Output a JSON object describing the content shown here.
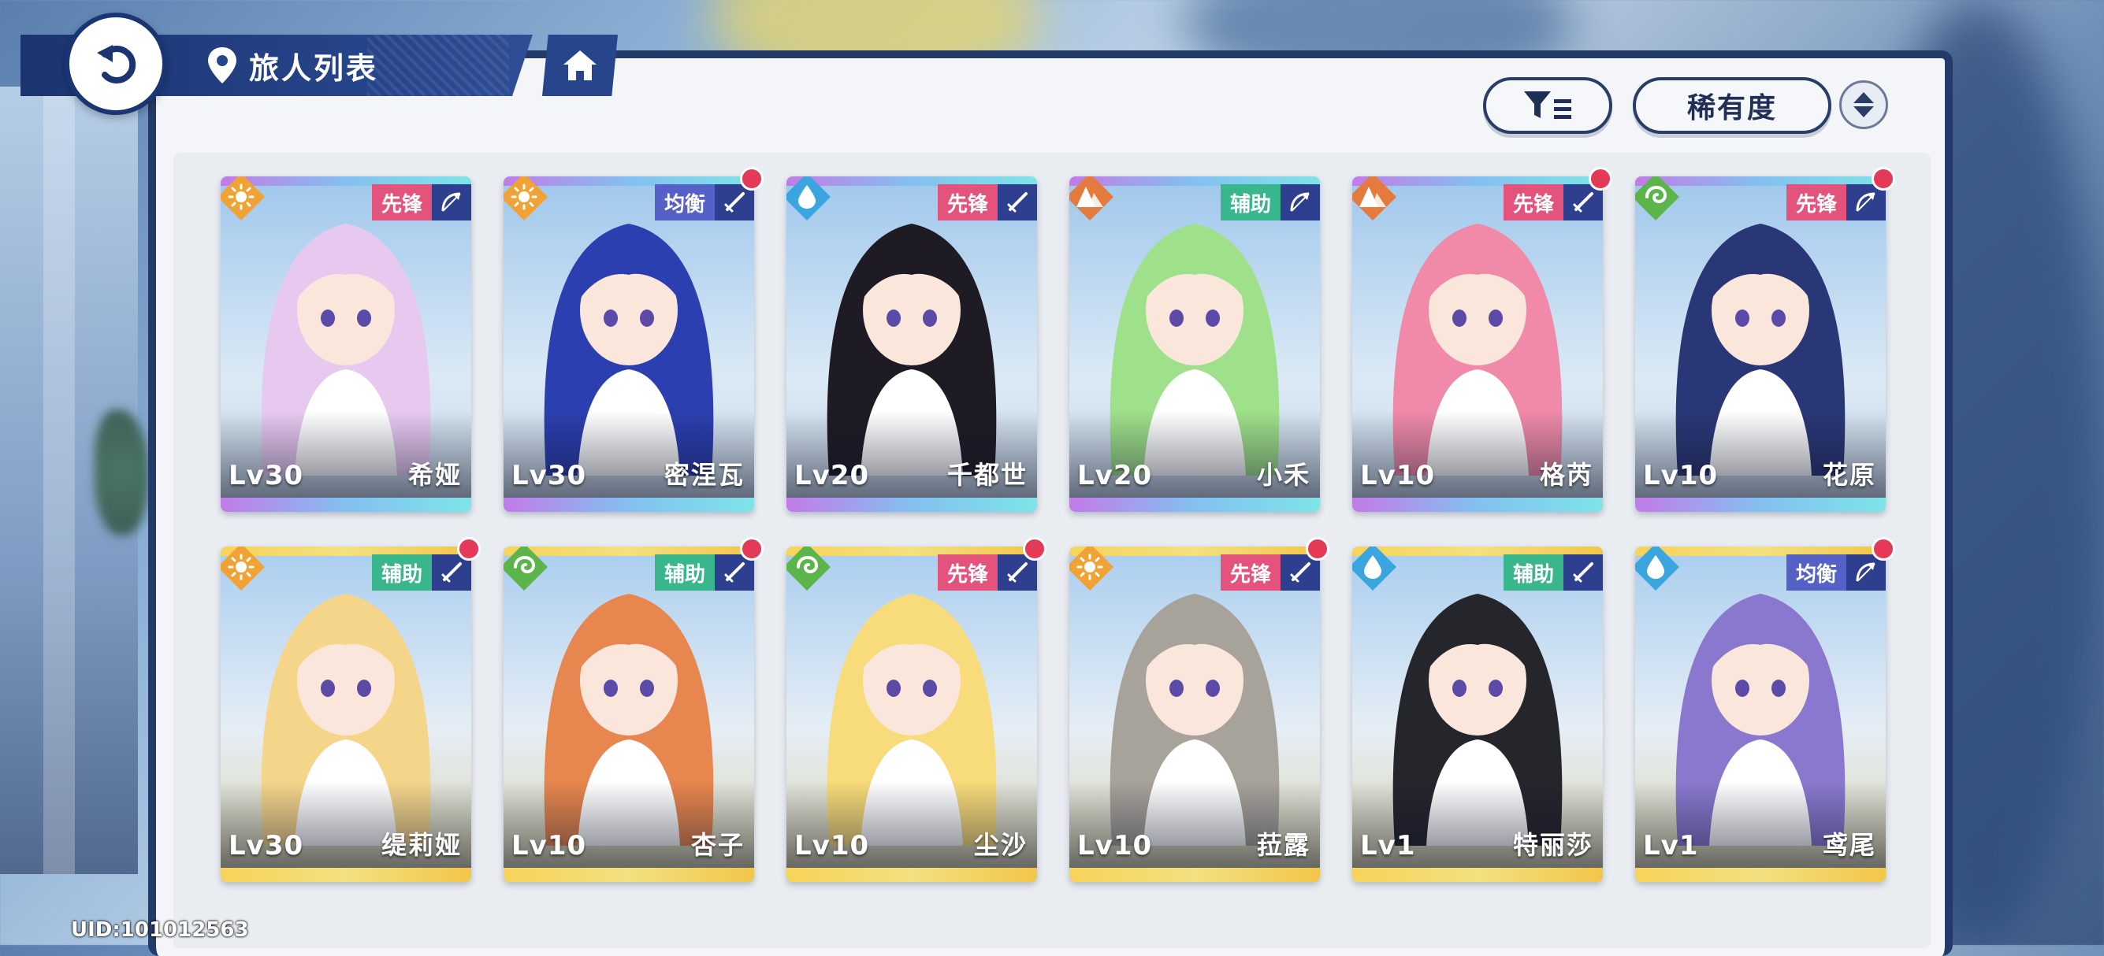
{
  "header": {
    "title": "旅人列表"
  },
  "toolbar": {
    "sort_label": "稀有度"
  },
  "uid_text": "UID:101012563",
  "colors": {
    "navy": "#1b3572",
    "role_vanguard": "#e3537c",
    "role_balance": "#5561c7",
    "role_support": "#39b68b",
    "element_sun": "#f0a234",
    "element_water": "#3aa5df",
    "element_earth": "#e57a3e",
    "element_wind": "#5bb54b",
    "notify": "#e43a57"
  },
  "characters": [
    {
      "name": "希娅",
      "level": "Lv30",
      "role": "先锋",
      "role_type": "vanguard",
      "element": "sun",
      "weapon": "bow-icon",
      "notify": false,
      "hair": "#e7c9f0",
      "frame": "#9fd8ee",
      "rarity": "ssr"
    },
    {
      "name": "密涅瓦",
      "level": "Lv30",
      "role": "均衡",
      "role_type": "balance",
      "element": "sun",
      "weapon": "sword-icon",
      "notify": true,
      "hair": "#2c3fb0",
      "frame": "#9fd8ee",
      "rarity": "ssr"
    },
    {
      "name": "千都世",
      "level": "Lv20",
      "role": "先锋",
      "role_type": "vanguard",
      "element": "water",
      "weapon": "sword-icon",
      "notify": false,
      "hair": "#1f1b24",
      "frame": "#9fd8ee",
      "rarity": "ssr"
    },
    {
      "name": "小禾",
      "level": "Lv20",
      "role": "辅助",
      "role_type": "support",
      "element": "earth",
      "weapon": "bow-icon",
      "notify": false,
      "hair": "#9fe08a",
      "frame": "#9fd8ee",
      "rarity": "ssr"
    },
    {
      "name": "格芮",
      "level": "Lv10",
      "role": "先锋",
      "role_type": "vanguard",
      "element": "earth",
      "weapon": "sword-icon",
      "notify": true,
      "hair": "#f08aa8",
      "frame": "#9fd8ee",
      "rarity": "ssr"
    },
    {
      "name": "花原",
      "level": "Lv10",
      "role": "先锋",
      "role_type": "vanguard",
      "element": "wind",
      "weapon": "bow-icon",
      "notify": true,
      "hair": "#2a3776",
      "frame": "#9fd8ee",
      "rarity": "ssr"
    },
    {
      "name": "缇莉娅",
      "level": "Lv30",
      "role": "辅助",
      "role_type": "support",
      "element": "sun",
      "weapon": "sword-icon",
      "notify": true,
      "hair": "#f5d58a",
      "frame": "#f2d24e",
      "rarity": "sr"
    },
    {
      "name": "杏子",
      "level": "Lv10",
      "role": "辅助",
      "role_type": "support",
      "element": "wind",
      "weapon": "sword-icon",
      "notify": true,
      "hair": "#e7864f",
      "frame": "#f2d24e",
      "rarity": "sr"
    },
    {
      "name": "尘沙",
      "level": "Lv10",
      "role": "先锋",
      "role_type": "vanguard",
      "element": "wind",
      "weapon": "sword-icon",
      "notify": true,
      "hair": "#f8db7a",
      "frame": "#f2d24e",
      "rarity": "sr"
    },
    {
      "name": "菈露",
      "level": "Lv10",
      "role": "先锋",
      "role_type": "vanguard",
      "element": "sun",
      "weapon": "sword-icon",
      "notify": true,
      "hair": "#a7a29a",
      "frame": "#f2d24e",
      "rarity": "sr"
    },
    {
      "name": "特丽莎",
      "level": "Lv1",
      "role": "辅助",
      "role_type": "support",
      "element": "water",
      "weapon": "sword-icon",
      "notify": false,
      "hair": "#25252c",
      "frame": "#f2d24e",
      "rarity": "sr"
    },
    {
      "name": "鸢尾",
      "level": "Lv1",
      "role": "均衡",
      "role_type": "balance",
      "element": "water",
      "weapon": "bow-icon",
      "notify": true,
      "hair": "#8a78cf",
      "frame": "#f2d24e",
      "rarity": "sr"
    }
  ]
}
